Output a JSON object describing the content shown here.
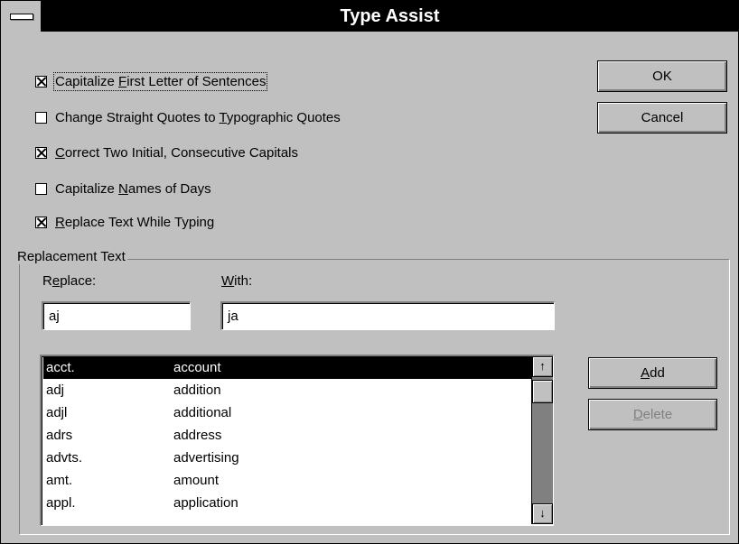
{
  "window": {
    "title": "Type Assist"
  },
  "options": [
    {
      "text": "Capitalize First Letter of Sentences",
      "checked": true
    },
    {
      "text": "Change Straight Quotes to Typographic Quotes",
      "checked": false
    },
    {
      "text": "Correct Two Initial, Consecutive Capitals",
      "checked": true
    },
    {
      "text": "Capitalize Names of Days",
      "checked": false
    },
    {
      "text": "Replace Text While Typing",
      "checked": true
    }
  ],
  "buttons": {
    "ok": "OK",
    "cancel": "Cancel",
    "add": "Add",
    "delete": "Delete"
  },
  "replacement": {
    "group_label": "Replacement Text",
    "replace_label": "Replace:",
    "with_label": "With:",
    "replace_value": "aj",
    "with_value": "ja",
    "entries": [
      {
        "abbr": "acct.",
        "full": "account",
        "selected": true
      },
      {
        "abbr": "adj",
        "full": "addition"
      },
      {
        "abbr": "adjl",
        "full": "additional"
      },
      {
        "abbr": "adrs",
        "full": "address"
      },
      {
        "abbr": "advts.",
        "full": "advertising"
      },
      {
        "abbr": "amt.",
        "full": "amount"
      },
      {
        "abbr": "appl.",
        "full": "application"
      }
    ]
  },
  "icons": {
    "scroll_up": "↑",
    "scroll_down": "↓"
  }
}
